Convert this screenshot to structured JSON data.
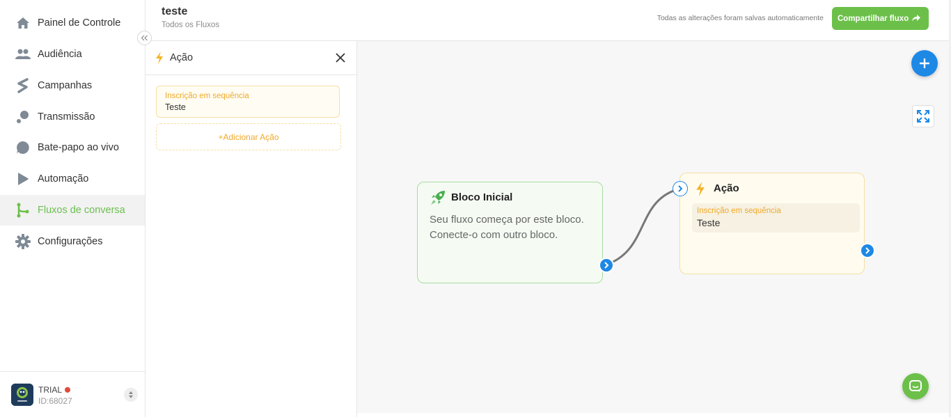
{
  "sidebar": {
    "items": [
      {
        "label": "Painel de Controle",
        "icon": "home-icon"
      },
      {
        "label": "Audiência",
        "icon": "people-icon"
      },
      {
        "label": "Campanhas",
        "icon": "campaign-icon"
      },
      {
        "label": "Transmissão",
        "icon": "broadcast-icon"
      },
      {
        "label": "Bate-papo ao vivo",
        "icon": "chat-bubble-icon"
      },
      {
        "label": "Automação",
        "icon": "automation-icon"
      },
      {
        "label": "Fluxos de conversa",
        "icon": "flow-branch-icon",
        "active": true
      },
      {
        "label": "Configurações",
        "icon": "gear-icon"
      }
    ],
    "account": {
      "plan": "TRIAL",
      "id": "ID:68027"
    }
  },
  "header": {
    "title": "teste",
    "breadcrumb": "Todos os Fluxos",
    "save_status": "Todas as alterações foram salvas automaticamente",
    "share_label": "Compartilhar fluxo"
  },
  "panel": {
    "title": "Ação",
    "action": {
      "kind": "Inscrição em sequência",
      "value": "Teste"
    },
    "add_label": "+Adicionar Ação"
  },
  "canvas": {
    "start_node": {
      "title": "Bloco Inicial",
      "description": "Seu fluxo começa por este bloco. Conecte-o com outro bloco."
    },
    "action_node": {
      "title": "Ação",
      "kind": "Inscrição em sequência",
      "value": "Teste"
    }
  },
  "colors": {
    "brand_green": "#6cc04a",
    "accent_blue": "#1e88e5",
    "action_orange": "#f0a92b"
  }
}
